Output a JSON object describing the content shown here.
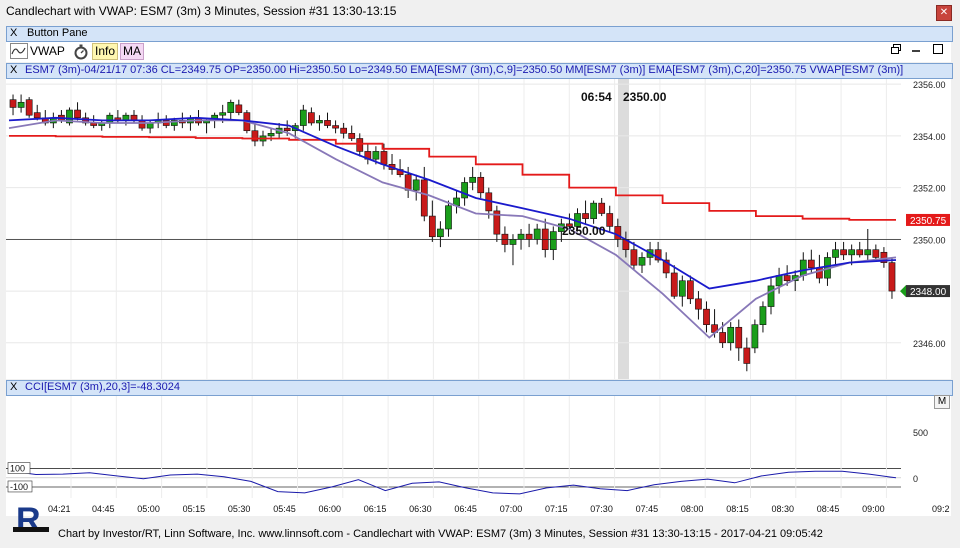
{
  "window": {
    "title": "Candlechart with VWAP: ESM7 (3m) 3 Minutes, Session #31 13:30-13:15",
    "close_icon": "close-icon"
  },
  "button_pane": {
    "close": "X",
    "label": "Button Pane"
  },
  "toolbar": {
    "vwap_label": "VWAP",
    "info_label": "Info",
    "ma_label": "MA",
    "vwap_icon": "wave-icon",
    "timer_icon": "stopwatch-icon",
    "restore_icon": "restore-icon",
    "maximize_icon": "maximize-icon"
  },
  "price_pane": {
    "close": "X",
    "legend": "ESM7 (3m)-04/21/17 07:36 CL=2349.75 OP=2350.00 Hi=2350.50 Lo=2349.50  EMA[ESM7 (3m),C,9]=2350.50  MM[ESM7 (3m)]  EMA[ESM7 (3m),C,20]=2350.75  VWAP[ESM7 (3m)]",
    "cursor_time": "06:54",
    "cursor_price": "2350.00",
    "crosshair_label": "2350.00",
    "price_axis": [
      "2356.00",
      "2354.00",
      "2352.00",
      "2350.00",
      "2348.00",
      "2346.00"
    ],
    "vwap_tag": "2350.75",
    "last_tag": "2348.00",
    "colors": {
      "up": "#1a9e1a",
      "down": "#c81a1a",
      "vwap": "#e41a1a",
      "ema20": "#1a1acc",
      "ema9": "#8878b8",
      "cursor_band": "#dcdcdc"
    }
  },
  "cci_pane": {
    "close": "X",
    "legend": "CCI[ESM7 (3m),20,3]=-48.3024",
    "m_button": "M",
    "axis": [
      "500",
      "0"
    ],
    "levels": [
      "100",
      "-100"
    ]
  },
  "time_axis": [
    "04:21",
    "04:45",
    "05:00",
    "05:15",
    "05:30",
    "05:45",
    "06:00",
    "06:15",
    "06:30",
    "06:45",
    "07:00",
    "07:15",
    "07:30",
    "07:45",
    "08:00",
    "08:15",
    "08:30",
    "08:45",
    "09:00",
    "09:2"
  ],
  "footer": {
    "text": "Chart by Investor/RT, Linn Software, Inc. www.linnsoft.com - Candlechart with VWAP: ESM7 (3m) 3 Minutes, Session #31 13:30-13:15 - 2017-04-21 09:05:42",
    "logo_icon": "investor-rt-logo"
  },
  "chart_data": {
    "type": "candlestick",
    "ylim": [
      2344.6,
      2356.2
    ],
    "candles": [
      [
        2355.4,
        2355.6,
        2354.8,
        2355.1
      ],
      [
        2355.1,
        2355.6,
        2354.9,
        2355.3
      ],
      [
        2355.4,
        2355.5,
        2354.7,
        2354.8
      ],
      [
        2354.9,
        2355.2,
        2354.6,
        2354.7
      ],
      [
        2354.7,
        2355.0,
        2354.4,
        2354.5
      ],
      [
        2354.5,
        2354.9,
        2354.3,
        2354.7
      ],
      [
        2354.8,
        2355.0,
        2354.5,
        2354.6
      ],
      [
        2354.5,
        2355.1,
        2354.4,
        2355.0
      ],
      [
        2355.0,
        2355.3,
        2354.6,
        2354.7
      ],
      [
        2354.7,
        2354.9,
        2354.4,
        2354.5
      ],
      [
        2354.5,
        2354.8,
        2354.3,
        2354.4
      ],
      [
        2354.4,
        2354.6,
        2354.2,
        2354.5
      ],
      [
        2354.5,
        2354.9,
        2354.3,
        2354.8
      ],
      [
        2354.7,
        2355.0,
        2354.5,
        2354.6
      ],
      [
        2354.6,
        2354.9,
        2354.4,
        2354.8
      ],
      [
        2354.8,
        2355.0,
        2354.5,
        2354.6
      ],
      [
        2354.6,
        2354.8,
        2354.2,
        2354.3
      ],
      [
        2354.3,
        2354.6,
        2354.1,
        2354.5
      ],
      [
        2354.5,
        2354.9,
        2354.3,
        2354.6
      ],
      [
        2354.6,
        2354.8,
        2354.3,
        2354.4
      ],
      [
        2354.4,
        2354.7,
        2354.2,
        2354.6
      ],
      [
        2354.6,
        2354.9,
        2354.3,
        2354.5
      ],
      [
        2354.5,
        2354.8,
        2354.2,
        2354.7
      ],
      [
        2354.7,
        2355.0,
        2354.4,
        2354.5
      ],
      [
        2354.5,
        2354.7,
        2354.1,
        2354.6
      ],
      [
        2354.6,
        2354.9,
        2354.3,
        2354.8
      ],
      [
        2354.8,
        2355.2,
        2354.5,
        2354.9
      ],
      [
        2354.9,
        2355.4,
        2354.6,
        2355.3
      ],
      [
        2355.2,
        2355.4,
        2354.8,
        2354.9
      ],
      [
        2354.9,
        2355.0,
        2354.1,
        2354.2
      ],
      [
        2354.2,
        2354.5,
        2353.6,
        2353.8
      ],
      [
        2353.8,
        2354.2,
        2353.6,
        2354.0
      ],
      [
        2354.0,
        2354.3,
        2353.8,
        2354.1
      ],
      [
        2354.1,
        2354.5,
        2353.9,
        2354.3
      ],
      [
        2354.3,
        2354.6,
        2354.0,
        2354.2
      ],
      [
        2354.2,
        2354.5,
        2353.9,
        2354.4
      ],
      [
        2354.4,
        2355.2,
        2354.2,
        2355.0
      ],
      [
        2354.9,
        2355.1,
        2354.4,
        2354.5
      ],
      [
        2354.5,
        2354.8,
        2354.2,
        2354.6
      ],
      [
        2354.6,
        2354.9,
        2354.3,
        2354.4
      ],
      [
        2354.4,
        2354.6,
        2354.1,
        2354.3
      ],
      [
        2354.3,
        2354.5,
        2353.9,
        2354.1
      ],
      [
        2354.1,
        2354.4,
        2353.8,
        2353.9
      ],
      [
        2353.9,
        2354.1,
        2353.2,
        2353.4
      ],
      [
        2353.4,
        2353.7,
        2352.9,
        2353.1
      ],
      [
        2353.1,
        2353.6,
        2352.9,
        2353.4
      ],
      [
        2353.4,
        2353.7,
        2352.7,
        2352.9
      ],
      [
        2352.9,
        2353.3,
        2352.5,
        2352.7
      ],
      [
        2352.7,
        2353.1,
        2352.4,
        2352.5
      ],
      [
        2352.5,
        2352.8,
        2351.6,
        2351.9
      ],
      [
        2351.9,
        2352.5,
        2351.5,
        2352.3
      ],
      [
        2352.3,
        2352.8,
        2350.7,
        2350.9
      ],
      [
        2350.9,
        2351.5,
        2349.9,
        2350.1
      ],
      [
        2350.1,
        2350.7,
        2349.7,
        2350.4
      ],
      [
        2350.4,
        2351.5,
        2350.1,
        2351.3
      ],
      [
        2351.3,
        2351.9,
        2351.0,
        2351.6
      ],
      [
        2351.6,
        2352.4,
        2351.3,
        2352.2
      ],
      [
        2352.2,
        2352.8,
        2351.9,
        2352.4
      ],
      [
        2352.4,
        2352.6,
        2351.6,
        2351.8
      ],
      [
        2351.8,
        2352.0,
        2350.8,
        2351.1
      ],
      [
        2351.1,
        2351.3,
        2349.9,
        2350.2
      ],
      [
        2350.2,
        2350.5,
        2349.5,
        2349.8
      ],
      [
        2349.8,
        2350.2,
        2349.0,
        2350.0
      ],
      [
        2350.0,
        2350.4,
        2349.6,
        2350.2
      ],
      [
        2350.2,
        2350.6,
        2349.7,
        2350.0
      ],
      [
        2350.0,
        2350.6,
        2349.8,
        2350.4
      ],
      [
        2350.4,
        2350.8,
        2349.3,
        2349.6
      ],
      [
        2349.6,
        2350.5,
        2349.2,
        2350.3
      ],
      [
        2350.3,
        2350.8,
        2349.9,
        2350.6
      ],
      [
        2350.6,
        2351.0,
        2350.2,
        2350.5
      ],
      [
        2350.5,
        2351.2,
        2350.3,
        2351.0
      ],
      [
        2351.0,
        2351.5,
        2350.6,
        2350.8
      ],
      [
        2350.8,
        2351.5,
        2350.6,
        2351.4
      ],
      [
        2351.4,
        2351.6,
        2350.9,
        2351.0
      ],
      [
        2351.0,
        2351.3,
        2350.3,
        2350.5
      ],
      [
        2350.5,
        2350.8,
        2349.7,
        2350.0
      ],
      [
        2350.0,
        2350.3,
        2349.3,
        2349.6
      ],
      [
        2349.6,
        2349.9,
        2348.8,
        2349.0
      ],
      [
        2349.0,
        2349.5,
        2348.7,
        2349.3
      ],
      [
        2349.3,
        2349.9,
        2349.0,
        2349.6
      ],
      [
        2349.6,
        2349.9,
        2349.1,
        2349.2
      ],
      [
        2349.2,
        2349.5,
        2348.5,
        2348.7
      ],
      [
        2348.7,
        2349.0,
        2347.7,
        2347.8
      ],
      [
        2347.8,
        2348.6,
        2347.4,
        2348.4
      ],
      [
        2348.4,
        2348.6,
        2347.5,
        2347.7
      ],
      [
        2347.7,
        2348.0,
        2346.9,
        2347.3
      ],
      [
        2347.3,
        2347.6,
        2346.4,
        2346.7
      ],
      [
        2346.7,
        2347.3,
        2346.2,
        2346.4
      ],
      [
        2346.4,
        2346.8,
        2345.8,
        2346.0
      ],
      [
        2346.0,
        2346.8,
        2345.7,
        2346.6
      ],
      [
        2346.6,
        2346.9,
        2345.3,
        2345.8
      ],
      [
        2345.8,
        2346.2,
        2344.9,
        2345.2
      ],
      [
        2345.8,
        2346.9,
        2345.6,
        2346.7
      ],
      [
        2346.7,
        2347.6,
        2346.4,
        2347.4
      ],
      [
        2347.4,
        2348.5,
        2347.1,
        2348.2
      ],
      [
        2348.2,
        2348.9,
        2347.9,
        2348.6
      ],
      [
        2348.6,
        2349.0,
        2348.2,
        2348.4
      ],
      [
        2348.4,
        2348.8,
        2348.0,
        2348.6
      ],
      [
        2348.6,
        2349.5,
        2348.4,
        2349.2
      ],
      [
        2349.2,
        2349.6,
        2348.7,
        2348.9
      ],
      [
        2348.9,
        2349.4,
        2348.3,
        2348.5
      ],
      [
        2348.5,
        2349.5,
        2348.2,
        2349.3
      ],
      [
        2349.3,
        2349.9,
        2349.0,
        2349.6
      ],
      [
        2349.6,
        2349.9,
        2349.2,
        2349.4
      ],
      [
        2349.4,
        2349.8,
        2349.0,
        2349.6
      ],
      [
        2349.6,
        2349.9,
        2349.3,
        2349.4
      ],
      [
        2349.4,
        2350.4,
        2349.2,
        2349.6
      ],
      [
        2349.6,
        2349.8,
        2349.2,
        2349.3
      ],
      [
        2349.5,
        2349.7,
        2348.9,
        2349.1
      ],
      [
        2349.1,
        2349.3,
        2347.7,
        2348.0
      ]
    ],
    "vwap": [
      2354.0,
      2353.98,
      2353.96,
      2353.95,
      2353.92,
      2353.9,
      2353.85,
      2353.7,
      2353.5,
      2353.2,
      2352.9,
      2352.5,
      2352.0,
      2351.7,
      2351.4,
      2351.1,
      2350.9,
      2350.8,
      2350.75
    ],
    "ema20": [
      2354.6,
      2354.7,
      2354.6,
      2354.6,
      2354.7,
      2354.6,
      2354.4,
      2353.6,
      2352.9,
      2352.3,
      2351.6,
      2351.2,
      2350.8,
      2350.2,
      2349.2,
      2348.1,
      2348.4,
      2348.8,
      2349.1,
      2349.2
    ],
    "ema9": [
      2354.3,
      2354.6,
      2354.5,
      2354.5,
      2354.6,
      2354.6,
      2354.1,
      2353.1,
      2352.2,
      2351.7,
      2351.0,
      2350.9,
      2350.4,
      2349.4,
      2347.9,
      2346.2,
      2347.7,
      2348.6,
      2349.1,
      2349.3
    ],
    "cci": [
      75,
      35,
      40,
      55,
      20,
      -10,
      30,
      40,
      10,
      -40,
      -150,
      -165,
      -100,
      -20,
      -140,
      -60,
      -45,
      -110,
      -165,
      -175,
      -110,
      -80,
      -120,
      -140,
      -75,
      -40,
      -15,
      -55,
      20,
      60,
      70,
      70,
      40,
      0
    ]
  }
}
